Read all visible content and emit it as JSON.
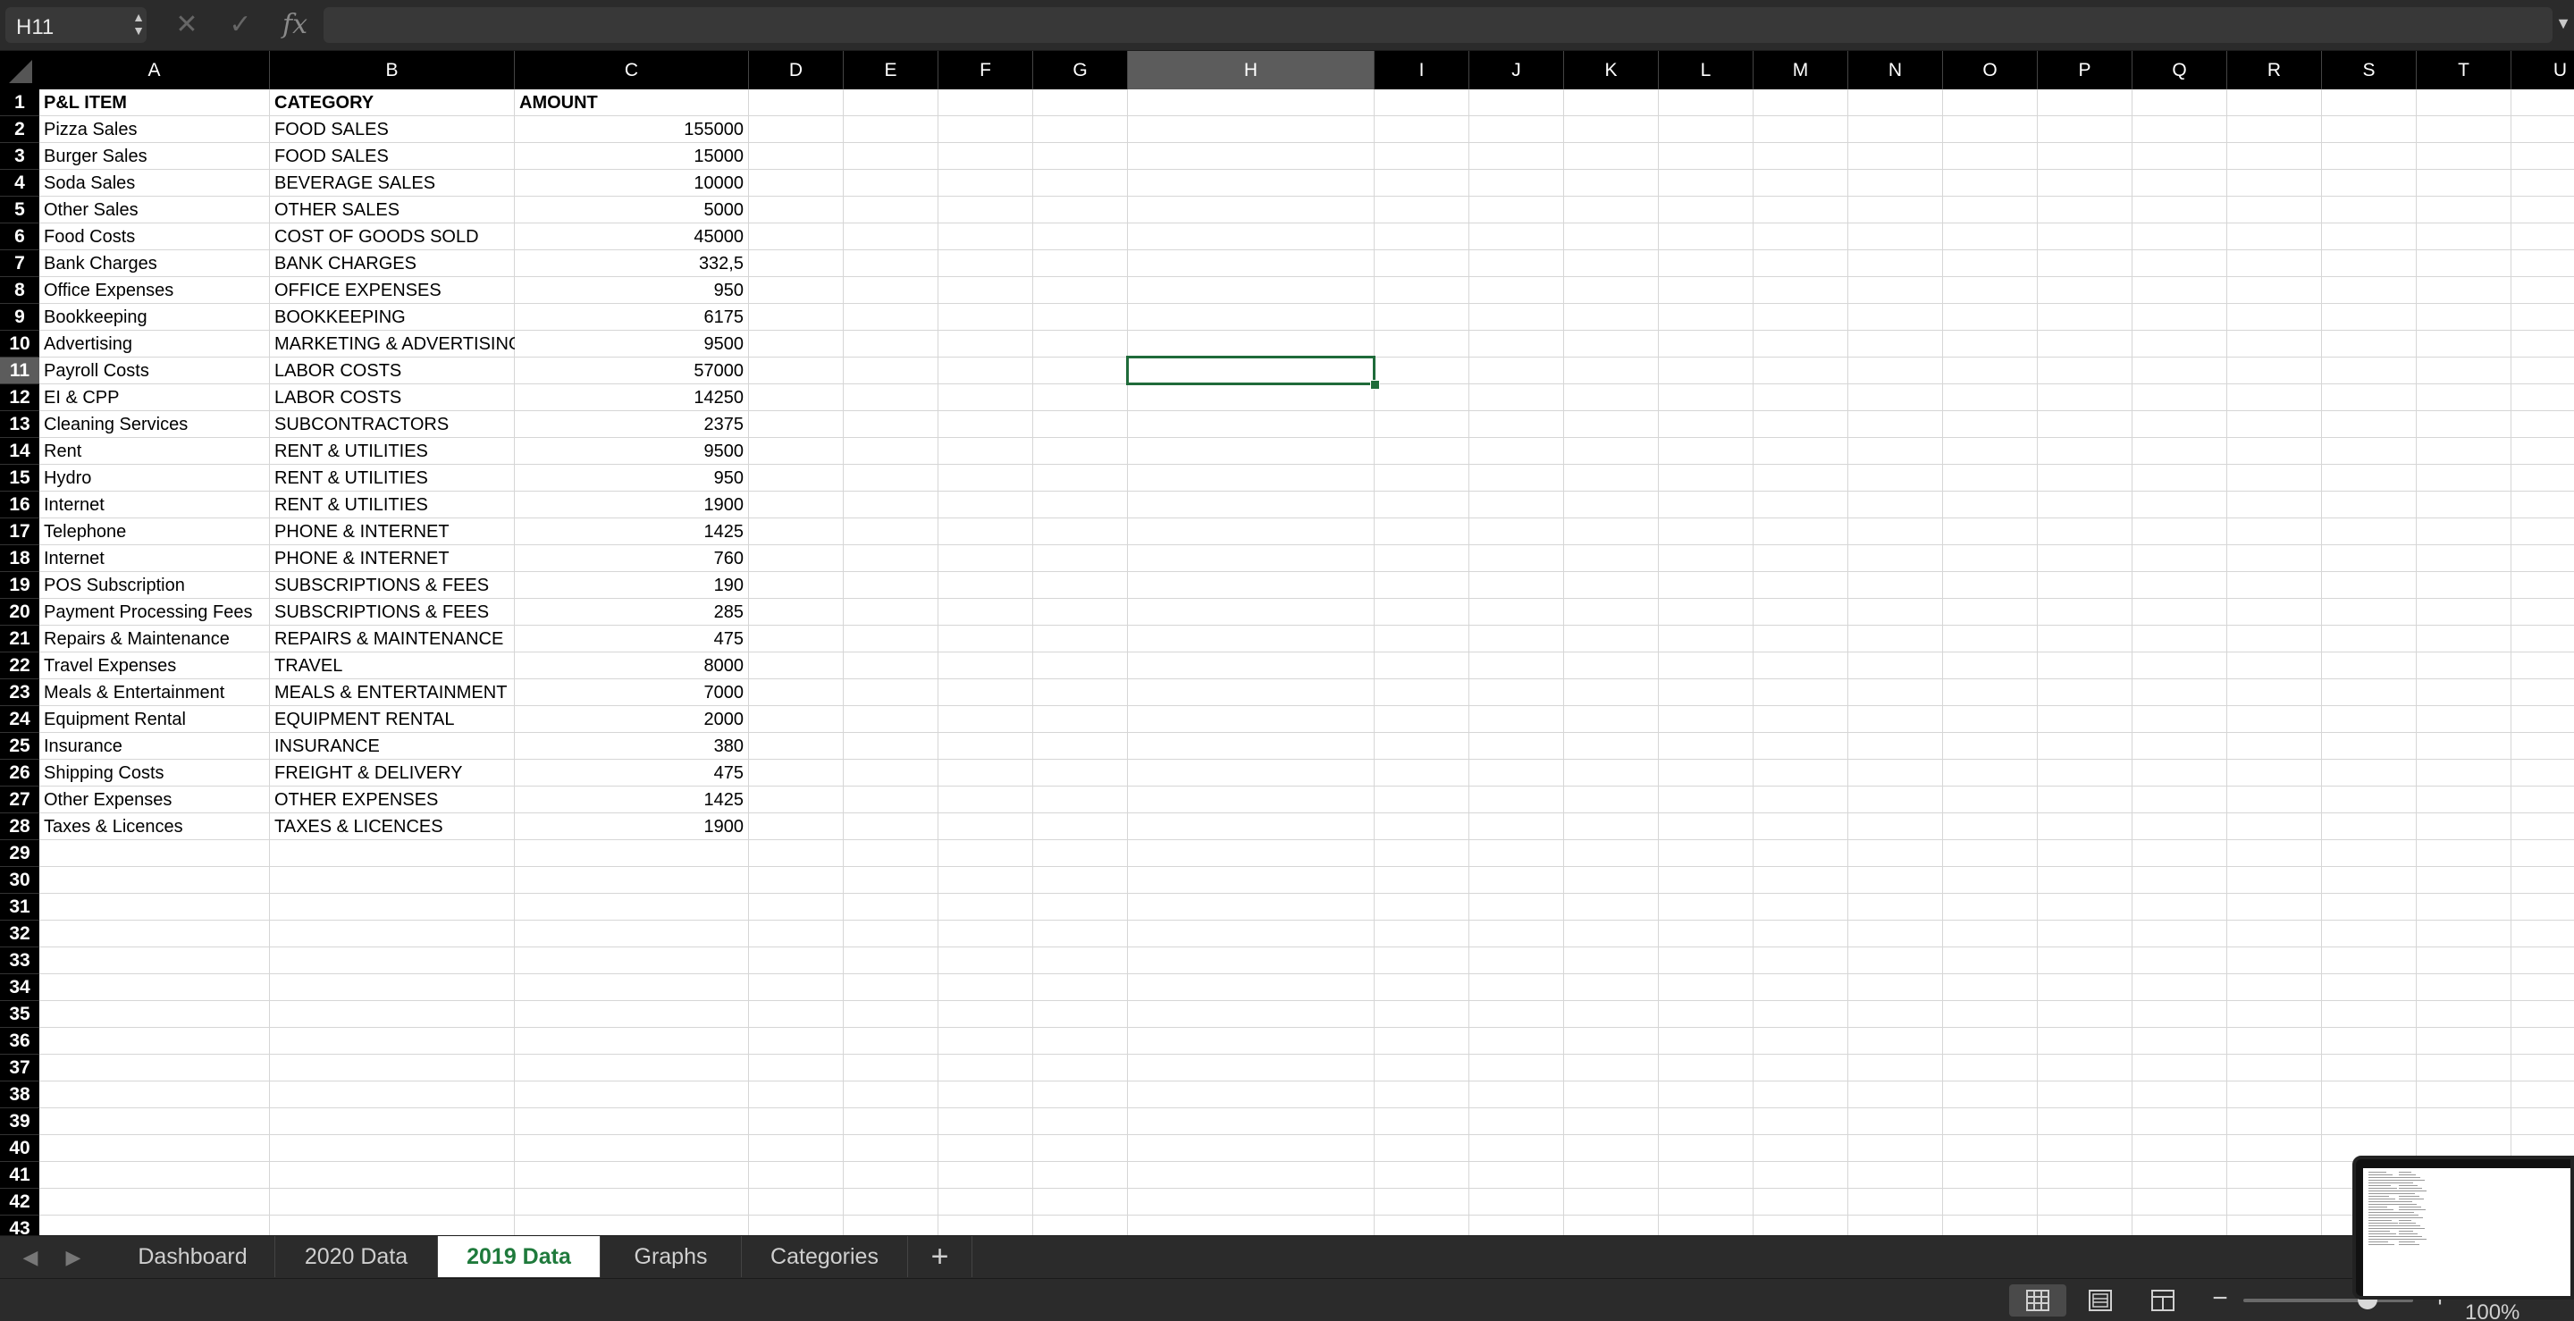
{
  "formula_bar": {
    "name_box": "H11",
    "formula_placeholder": "",
    "fx_label": "fx"
  },
  "columns": [
    "A",
    "B",
    "C",
    "D",
    "E",
    "F",
    "G",
    "H",
    "I",
    "J",
    "K",
    "L",
    "M",
    "N",
    "O",
    "P",
    "Q",
    "R",
    "S",
    "T",
    "U"
  ],
  "selected_column": "H",
  "selected_row": 11,
  "row_count": 43,
  "rows": [
    {
      "A": "P&L ITEM",
      "B": "CATEGORY",
      "C": "AMOUNT",
      "header": true
    },
    {
      "A": "Pizza Sales",
      "B": "FOOD SALES",
      "C": "155000"
    },
    {
      "A": "Burger Sales",
      "B": "FOOD SALES",
      "C": "15000"
    },
    {
      "A": "Soda Sales",
      "B": "BEVERAGE SALES",
      "C": "10000"
    },
    {
      "A": "Other Sales",
      "B": "OTHER SALES",
      "C": "5000"
    },
    {
      "A": "Food Costs",
      "B": "COST OF GOODS SOLD",
      "C": "45000"
    },
    {
      "A": "Bank Charges",
      "B": "BANK CHARGES",
      "C": "332,5"
    },
    {
      "A": "Office Expenses",
      "B": "OFFICE EXPENSES",
      "C": "950"
    },
    {
      "A": "Bookkeeping",
      "B": "BOOKKEEPING",
      "C": "6175"
    },
    {
      "A": "Advertising",
      "B": "MARKETING & ADVERTISING",
      "C": "9500"
    },
    {
      "A": "Payroll Costs",
      "B": "LABOR COSTS",
      "C": "57000"
    },
    {
      "A": "EI & CPP",
      "B": "LABOR COSTS",
      "C": "14250"
    },
    {
      "A": "Cleaning Services",
      "B": "SUBCONTRACTORS",
      "C": "2375"
    },
    {
      "A": "Rent",
      "B": "RENT & UTILITIES",
      "C": "9500"
    },
    {
      "A": "Hydro",
      "B": "RENT & UTILITIES",
      "C": "950"
    },
    {
      "A": "Internet",
      "B": "RENT & UTILITIES",
      "C": "1900"
    },
    {
      "A": "Telephone",
      "B": "PHONE & INTERNET",
      "C": "1425"
    },
    {
      "A": "Internet",
      "B": "PHONE & INTERNET",
      "C": "760"
    },
    {
      "A": "POS Subscription",
      "B": "SUBSCRIPTIONS & FEES",
      "C": "190"
    },
    {
      "A": "Payment Processing Fees",
      "B": "SUBSCRIPTIONS & FEES",
      "C": "285"
    },
    {
      "A": "Repairs & Maintenance",
      "B": "REPAIRS & MAINTENANCE",
      "C": "475"
    },
    {
      "A": "Travel Expenses",
      "B": "TRAVEL",
      "C": "8000"
    },
    {
      "A": "Meals & Entertainment",
      "B": "MEALS & ENTERTAINMENT",
      "C": "7000"
    },
    {
      "A": "Equipment Rental",
      "B": "EQUIPMENT RENTAL",
      "C": "2000"
    },
    {
      "A": "Insurance",
      "B": "INSURANCE",
      "C": "380"
    },
    {
      "A": "Shipping Costs",
      "B": "FREIGHT & DELIVERY",
      "C": "475"
    },
    {
      "A": "Other Expenses",
      "B": "OTHER EXPENSES",
      "C": "1425"
    },
    {
      "A": "Taxes & Licences",
      "B": "TAXES & LICENCES",
      "C": "1900"
    }
  ],
  "sheet_tabs": [
    {
      "label": "Dashboard",
      "active": false
    },
    {
      "label": "2020 Data",
      "active": false
    },
    {
      "label": "2019 Data",
      "active": true
    },
    {
      "label": "Graphs",
      "active": false
    },
    {
      "label": "Categories",
      "active": false
    }
  ],
  "add_sheet_label": "+",
  "status_bar": {
    "zoom_label": "100%",
    "zoom_percent": 100
  },
  "colors": {
    "accent_green": "#1f6b3a",
    "active_tab_text": "#1f7a3c",
    "chrome_bg": "#2b2b2b",
    "header_bg": "#000000"
  }
}
